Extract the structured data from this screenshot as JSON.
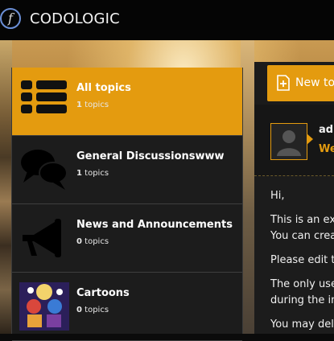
{
  "header": {
    "logo_glyph": "f",
    "brand": "CODOLOGIC"
  },
  "sidebar": {
    "categories": [
      {
        "title": "All topics",
        "count": "1",
        "count_label": "topics",
        "icon": "list-icon",
        "active": true
      },
      {
        "title": "General Discussionswww",
        "count": "1",
        "count_label": "topics",
        "icon": "speech-bubbles-icon",
        "active": false
      },
      {
        "title": "News and Announcements",
        "count": "0",
        "count_label": "topics",
        "icon": "megaphone-icon",
        "active": false
      },
      {
        "title": "Cartoons",
        "count": "0",
        "count_label": "topics",
        "icon": "cartoon-thumbnail",
        "active": false
      }
    ]
  },
  "topic_panel": {
    "new_topic_label": "New top",
    "post": {
      "author": "adr",
      "title": "We",
      "lines": [
        "Hi,",
        "This is an ex",
        "You can crea",
        "Please edit t",
        "The only use",
        "during the in",
        "You may del"
      ]
    }
  },
  "colors": {
    "accent": "#e49b0f",
    "panel": "#1c1c1c",
    "header": "#050505"
  }
}
